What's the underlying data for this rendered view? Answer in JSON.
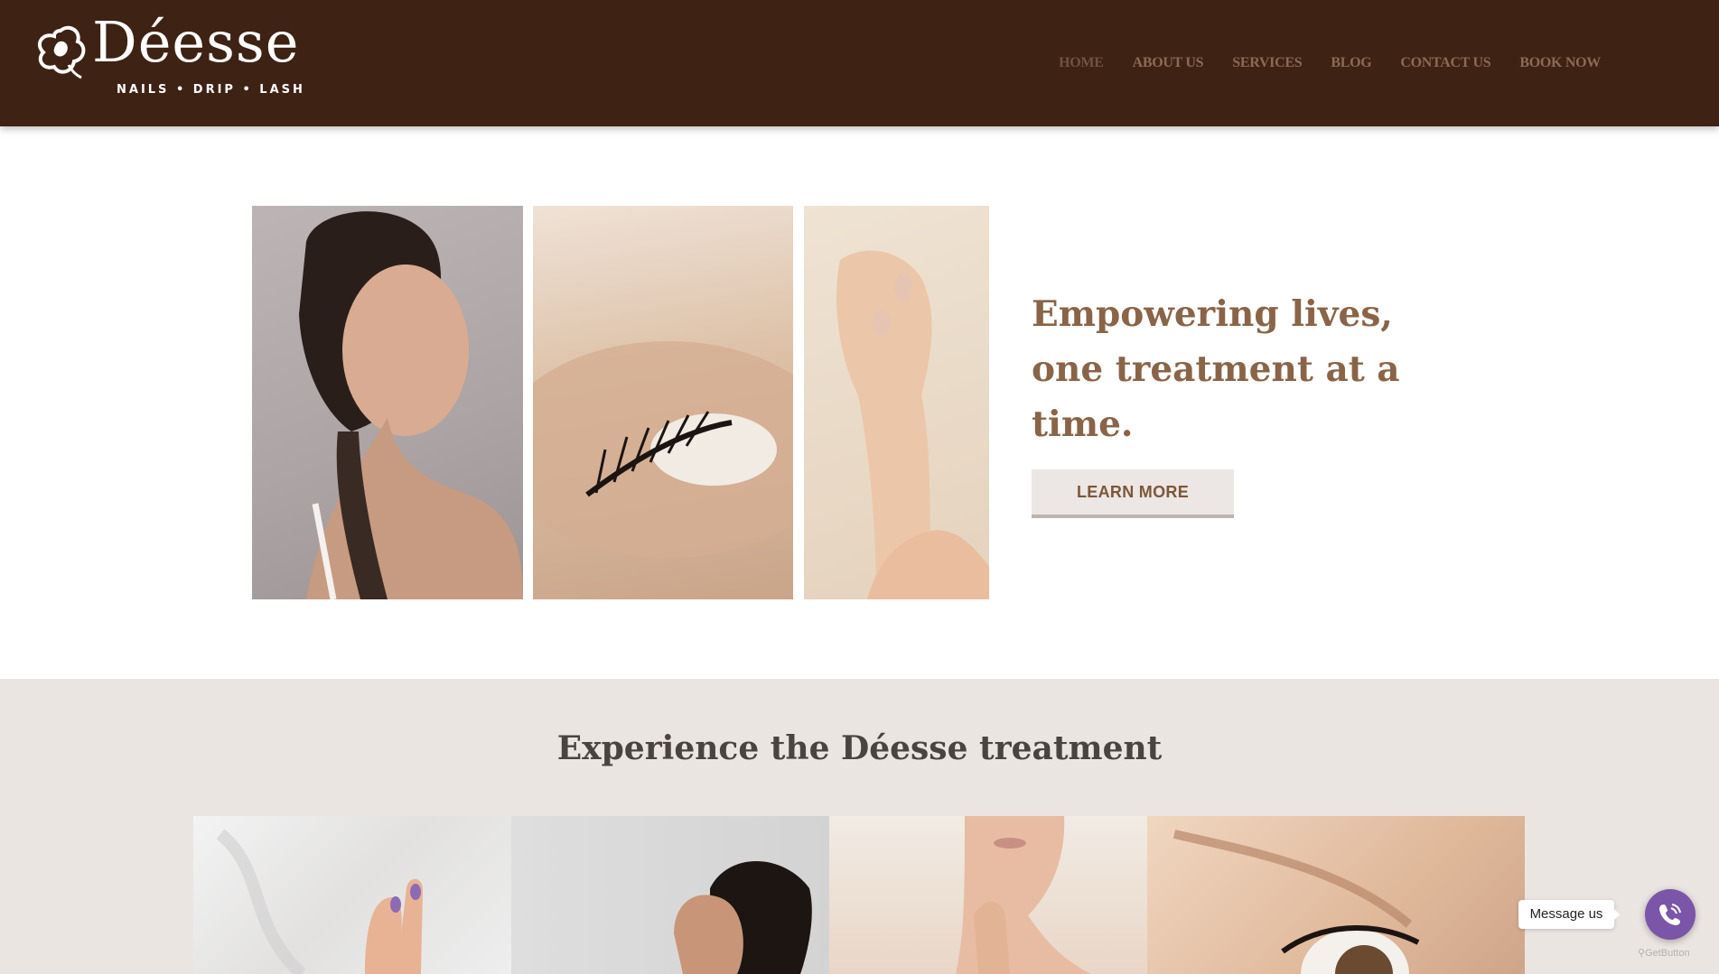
{
  "brand": {
    "name": "Déesse",
    "tagline": "NAILS • DRIP • LASH"
  },
  "nav": {
    "items": [
      {
        "label": "HOME",
        "active": true
      },
      {
        "label": "ABOUT US"
      },
      {
        "label": "SERVICES"
      },
      {
        "label": "BLOG"
      },
      {
        "label": "CONTACT US"
      },
      {
        "label": "BOOK NOW"
      }
    ]
  },
  "hero": {
    "title": "Empowering lives, one treatment at a time.",
    "button_label": "LEARN MORE"
  },
  "experience": {
    "title": "Experience the Déesse treatment"
  },
  "widget": {
    "message_label": "Message us",
    "credit": "GetButton"
  },
  "colors": {
    "header_bg": "#3e2214",
    "accent_brown": "#8a6447",
    "section_bg": "#ebe5e2",
    "widget_purple": "#7b55a8"
  }
}
